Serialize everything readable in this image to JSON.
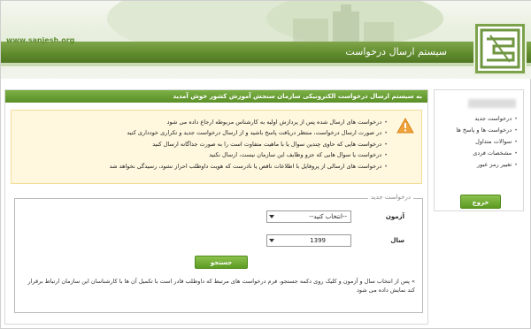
{
  "header": {
    "site_url": "www.sanjesh.org",
    "title": "سیستم ارسال درخواست"
  },
  "welcome": {
    "text": "به سیستم ارسال درخواست الکترونیکی سازمان سنجش آموزش کشور خوش آمدید"
  },
  "alert": {
    "icon": "warning-icon",
    "items": [
      "درخواست های ارسال شده پس از پردازش اولیه به کارشناس مربوطه ارجاع داده می شود",
      "در صورت ارسال درخواست، منتظر دریافت پاسخ باشید و از ارسال درخواست جدید و تکراری خودداری کنید",
      "درخواست هایی که حاوی چندین سوال یا با ماهیت متفاوت است را به صورت جداگانه ارسال کنید",
      "درخواست یا سوال هایی که جزو وظایف این سازمان نیست، ارسال نکنید",
      "درخواست های ارسالی از پروفایل با اطلاعات ناقص یا نادرست که هویت داوطلب احراز نشود، رسیدگی نخواهد شد"
    ]
  },
  "form": {
    "legend": "درخواست جدید",
    "exam_label": "آزمون",
    "exam_value": "--انتخاب کنید--",
    "year_label": "سال",
    "year_value": "1399",
    "search_label": "جستجو",
    "note": "» پس از انتخاب سال و آزمون و کلیک روی دکمه جستجو، فرم درخواست های مرتبط که داوطلب قادر است با تکمیل آن ها با کارشناسان این سازمان ارتباط برقرار کند نمایش داده می شود"
  },
  "sidebar": {
    "items": [
      {
        "label": "درخواست جدید"
      },
      {
        "label": "درخواست ها و پاسخ ها"
      },
      {
        "label": "سوالات متداول"
      },
      {
        "label": "مشخصات فردی"
      },
      {
        "label": "تغییر رمز عبور"
      }
    ],
    "logout_label": "خروج"
  },
  "colors": {
    "accent_green": "#5f8a2c",
    "alert_bg": "#fff8df",
    "warning_orange": "#f0a23a"
  }
}
